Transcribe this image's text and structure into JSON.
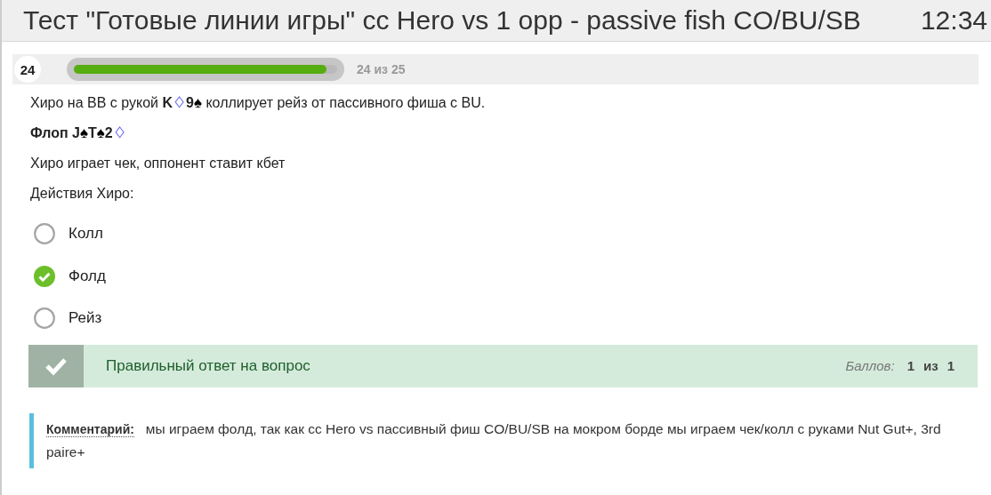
{
  "header": {
    "title": "Тест \"Готовые линии игры\" cc Hero vs 1 opp - passive fish CO/BU/SB",
    "time": "12:34"
  },
  "progress": {
    "number": "24",
    "level": 0.96,
    "label": "24 из 25"
  },
  "question": {
    "hand": {
      "before": "Хиро на BB с рукой",
      "cards": [
        {
          "rank": "K",
          "suit": "♢",
          "color": "#6f6ff5"
        },
        {
          "rank": "9",
          "suit": "♠",
          "color": "#000000"
        }
      ],
      "after": "коллирует рейз от пассивного фиша с BU."
    },
    "flop": {
      "label": "Флоп",
      "cards": [
        {
          "rank": "J",
          "suit": "♠",
          "color": "#000000"
        },
        {
          "rank": "T",
          "suit": "♠",
          "color": "#000000"
        },
        {
          "rank": "2",
          "suit": "♢",
          "color": "#6f6ff5"
        }
      ]
    },
    "lines": [
      "Хиро играет чек, оппонент ставит кбет",
      "Действия Хиро:"
    ]
  },
  "options": [
    {
      "label": "Колл",
      "selected": false
    },
    {
      "label": "Фолд",
      "selected": true
    },
    {
      "label": "Рейз",
      "selected": false
    }
  ],
  "result": {
    "text": "Правильный ответ на вопрос",
    "score_label": "Баллов:",
    "score": "1",
    "of": "из",
    "max": "1"
  },
  "comment": {
    "label": "Комментарий:",
    "text": "мы играем фолд, так как cc Hero vs пассивный фиш CO/BU/SB на мокром борде мы играем чек/колл с руками Nut Gut+, 3rd paire+"
  }
}
